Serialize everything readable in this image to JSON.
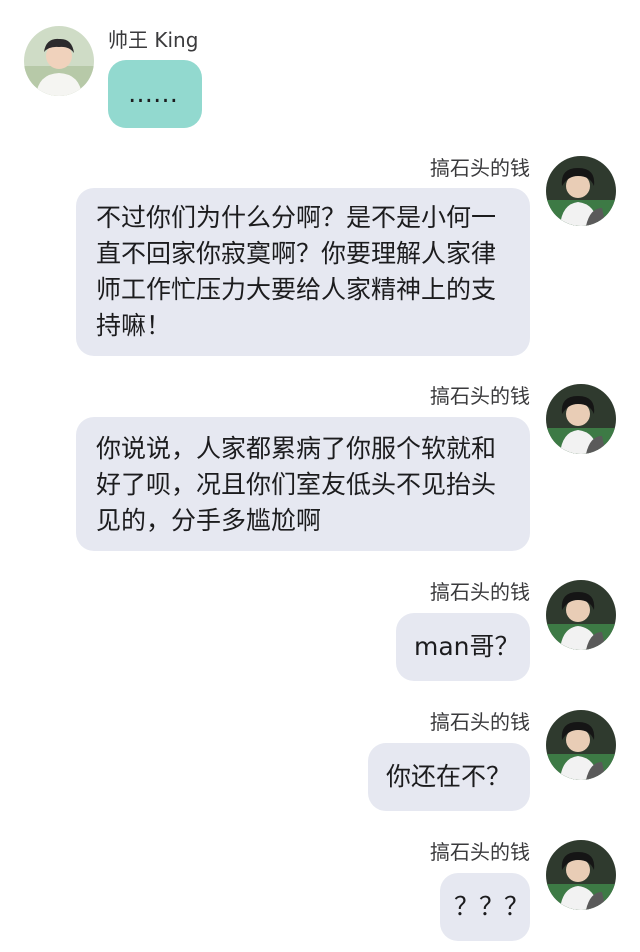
{
  "chat": {
    "messages": [
      {
        "sender": "帅王 King",
        "side": "left",
        "text": "……"
      },
      {
        "sender": "搞石头的钱",
        "side": "right",
        "text": "不过你们为什么分啊？是不是小何一直不回家你寂寞啊？你要理解人家律师工作忙压力大要给人家精神上的支持嘛！"
      },
      {
        "sender": "搞石头的钱",
        "side": "right",
        "text": "你说说，人家都累病了你服个软就和好了呗，况且你们室友低头不见抬头见的，分手多尴尬啊"
      },
      {
        "sender": "搞石头的钱",
        "side": "right",
        "text": "man哥？"
      },
      {
        "sender": "搞石头的钱",
        "side": "right",
        "text": "你还在不？"
      },
      {
        "sender": "搞石头的钱",
        "side": "right",
        "text": "？？？"
      }
    ]
  },
  "colors": {
    "incoming_bubble": "#92d9cf",
    "outgoing_bubble": "#e6e8f1",
    "background": "#ffffff"
  },
  "icons": {
    "left_avatar": "user-avatar-icon",
    "right_avatar": "user-avatar-icon"
  }
}
